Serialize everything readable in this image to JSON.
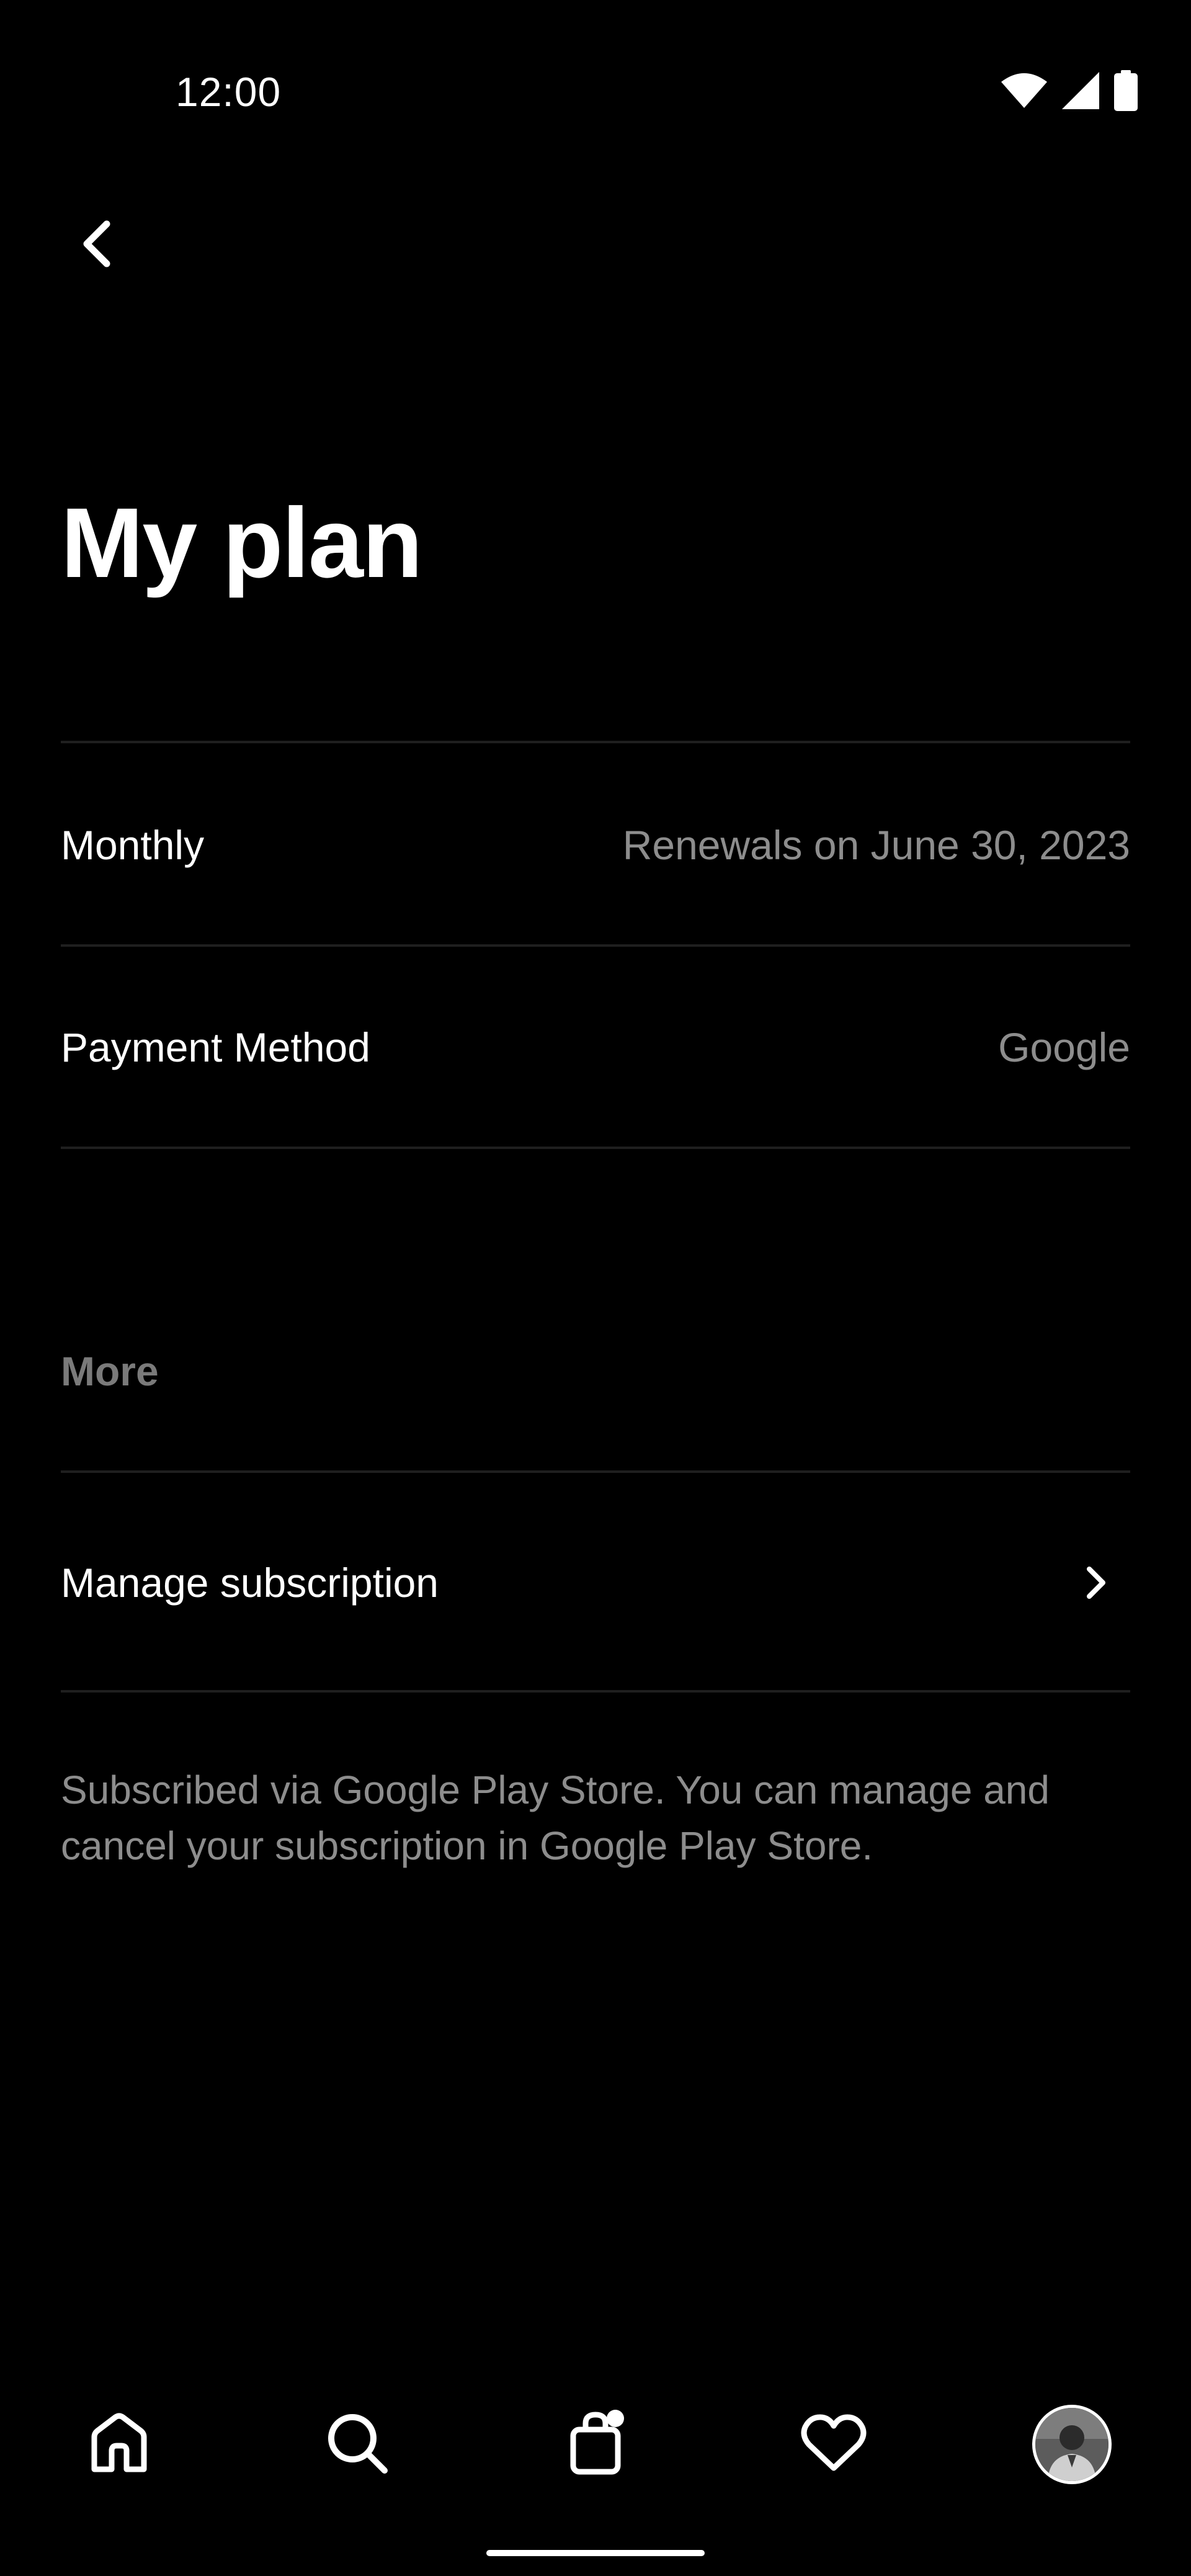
{
  "status_bar": {
    "time": "12:00",
    "icons": [
      "wifi-icon",
      "cell-signal-icon",
      "battery-icon"
    ]
  },
  "header": {
    "back_icon": "chevron-left-icon",
    "title": "My plan"
  },
  "plan": {
    "rows": [
      {
        "label": "Monthly",
        "value": "Renewals on June 30, 2023"
      },
      {
        "label": "Payment Method",
        "value": "Google"
      }
    ]
  },
  "more": {
    "heading": "More",
    "manage_label": "Manage subscription",
    "manage_icon": "chevron-right-icon",
    "note": "Subscribed via Google Play Store. You can manage and cancel your subscription in Google Play Store."
  },
  "bottom_nav": {
    "items": [
      {
        "icon": "home-icon"
      },
      {
        "icon": "search-icon"
      },
      {
        "icon": "shopping-bag-icon",
        "has_badge": true
      },
      {
        "icon": "heart-icon"
      },
      {
        "icon": "profile-avatar"
      }
    ]
  },
  "colors": {
    "background": "#000000",
    "text_primary": "#ffffff",
    "text_secondary": "#8d8d8d",
    "divider": "#1f1f1f"
  }
}
